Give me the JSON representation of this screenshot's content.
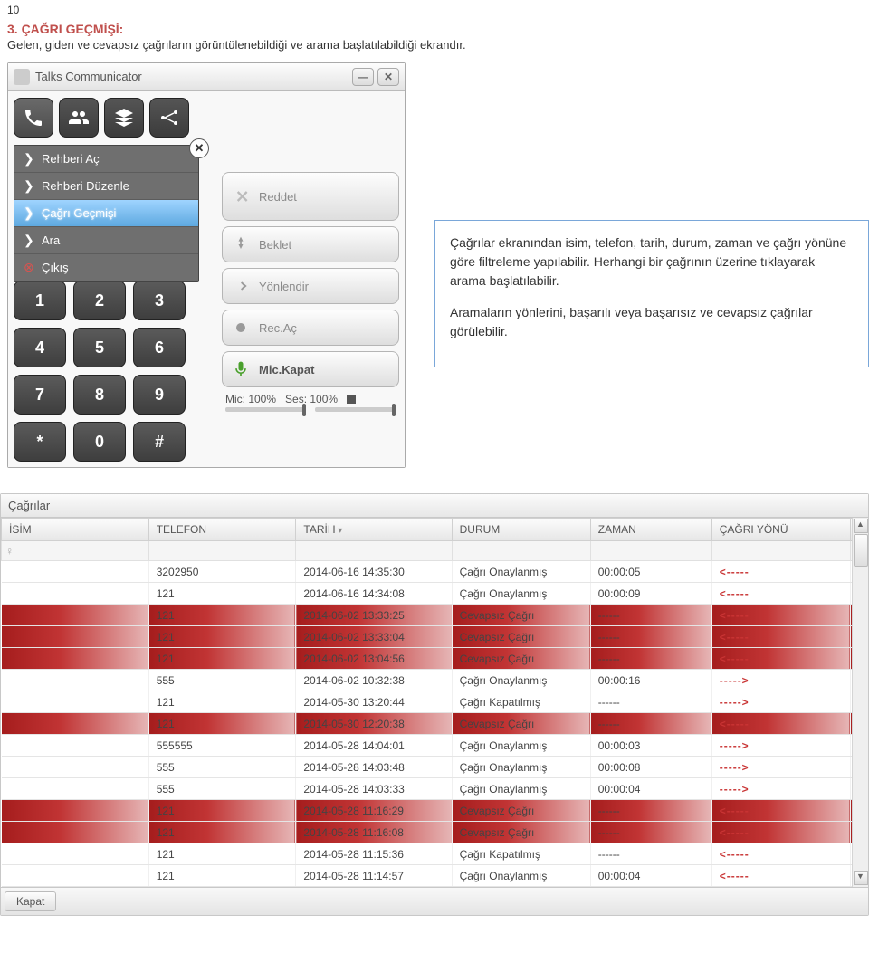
{
  "page_number": "10",
  "section": {
    "title": "3. ÇAĞRI GEÇMİŞİ:",
    "desc": "Gelen, giden ve cevapsız çağrıların görüntülenebildiği ve arama başlatılabildiği ekrandır."
  },
  "app": {
    "title": "Talks Communicator",
    "menu": {
      "items": [
        {
          "label": "Rehberi Aç",
          "type": "chev"
        },
        {
          "label": "Rehberi Düzenle",
          "type": "chev"
        },
        {
          "label": "Çağrı Geçmişi",
          "type": "chev",
          "selected": true
        },
        {
          "label": "Ara",
          "type": "chev"
        },
        {
          "label": "Çıkış",
          "type": "exit"
        }
      ]
    },
    "keypad": [
      "1",
      "2",
      "3",
      "4",
      "5",
      "6",
      "7",
      "8",
      "9",
      "*",
      "0",
      "#"
    ],
    "actions": {
      "reject": "Reddet",
      "hold": "Beklet",
      "transfer": "Yönlendir",
      "record": "Rec.Aç",
      "mic": "Mic.Kapat"
    },
    "status": {
      "mic": "Mic: 100%",
      "vol": "Ses: 100%"
    }
  },
  "info": {
    "p1": "Çağrılar ekranından isim, telefon, tarih, durum, zaman ve çağrı yönüne göre filtreleme yapılabilir. Herhangi bir çağrının üzerine tıklayarak arama başlatılabilir.",
    "p2": "Aramaların yönlerini, başarılı veya başarısız ve cevapsız çağrılar görülebilir."
  },
  "calls": {
    "title": "Çağrılar",
    "columns": {
      "name": "İSİM",
      "phone": "TELEFON",
      "date": "TARİH",
      "status": "DURUM",
      "time": "ZAMAN",
      "dir": "ÇAĞRI YÖNÜ"
    },
    "rows": [
      {
        "name": "",
        "phone": "3202950",
        "date": "2014-06-16 14:35:30",
        "status": "Çağrı Onaylanmış",
        "time": "00:00:05",
        "dir": "<-----",
        "missed": false
      },
      {
        "name": "",
        "phone": "121",
        "date": "2014-06-16 14:34:08",
        "status": "Çağrı Onaylanmış",
        "time": "00:00:09",
        "dir": "<-----",
        "missed": false
      },
      {
        "name": "",
        "phone": "121",
        "date": "2014-06-02 13:33:25",
        "status": "Cevapsız Çağrı",
        "time": "------",
        "dir": "<-----",
        "missed": true
      },
      {
        "name": "",
        "phone": "121",
        "date": "2014-06-02 13:33:04",
        "status": "Cevapsız Çağrı",
        "time": "------",
        "dir": "<-----",
        "missed": true
      },
      {
        "name": "",
        "phone": "121",
        "date": "2014-06-02 13:04:56",
        "status": "Cevapsız Çağrı",
        "time": "------",
        "dir": "<-----",
        "missed": true
      },
      {
        "name": "",
        "phone": "555",
        "date": "2014-06-02 10:32:38",
        "status": "Çağrı Onaylanmış",
        "time": "00:00:16",
        "dir": "----->",
        "missed": false
      },
      {
        "name": "",
        "phone": "121",
        "date": "2014-05-30 13:20:44",
        "status": "Çağrı Kapatılmış",
        "time": "------",
        "dir": "----->",
        "missed": false
      },
      {
        "name": "",
        "phone": "121",
        "date": "2014-05-30 12:20:38",
        "status": "Cevapsız Çağrı",
        "time": "------",
        "dir": "<-----",
        "missed": true
      },
      {
        "name": "",
        "phone": "555555",
        "date": "2014-05-28 14:04:01",
        "status": "Çağrı Onaylanmış",
        "time": "00:00:03",
        "dir": "----->",
        "missed": false
      },
      {
        "name": "",
        "phone": "555",
        "date": "2014-05-28 14:03:48",
        "status": "Çağrı Onaylanmış",
        "time": "00:00:08",
        "dir": "----->",
        "missed": false
      },
      {
        "name": "",
        "phone": "555",
        "date": "2014-05-28 14:03:33",
        "status": "Çağrı Onaylanmış",
        "time": "00:00:04",
        "dir": "----->",
        "missed": false
      },
      {
        "name": "",
        "phone": "121",
        "date": "2014-05-28 11:16:29",
        "status": "Cevapsız Çağrı",
        "time": "------",
        "dir": "<-----",
        "missed": true
      },
      {
        "name": "",
        "phone": "121",
        "date": "2014-05-28 11:16:08",
        "status": "Cevapsız Çağrı",
        "time": "------",
        "dir": "<-----",
        "missed": true
      },
      {
        "name": "",
        "phone": "121",
        "date": "2014-05-28 11:15:36",
        "status": "Çağrı Kapatılmış",
        "time": "------",
        "dir": "<-----",
        "missed": false
      },
      {
        "name": "",
        "phone": "121",
        "date": "2014-05-28 11:14:57",
        "status": "Çağrı Onaylanmış",
        "time": "00:00:04",
        "dir": "<-----",
        "missed": false
      }
    ],
    "footer_close": "Kapat"
  }
}
